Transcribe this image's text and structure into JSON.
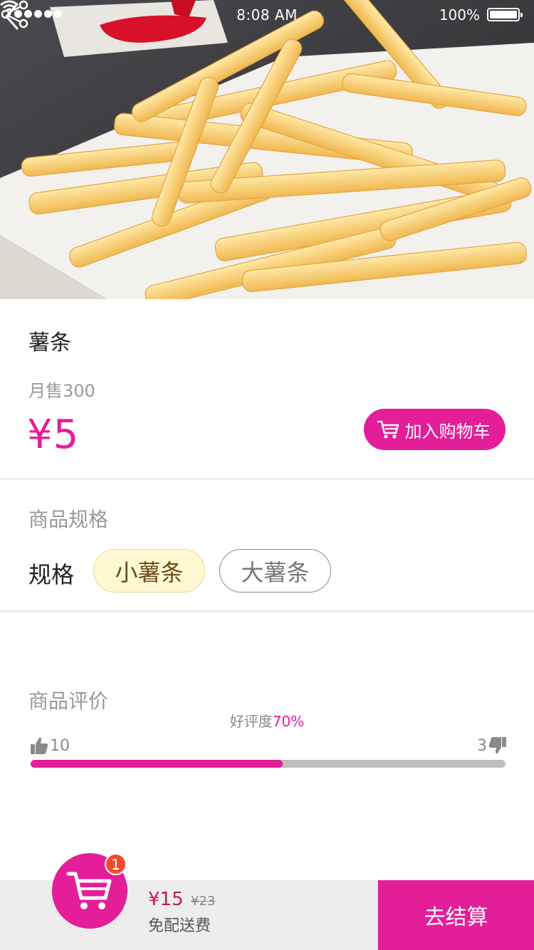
{
  "status_bar": {
    "time": "8:08 AM",
    "battery": "100%"
  },
  "product": {
    "name": "薯条",
    "monthly_sales": "月售300",
    "price": "¥5",
    "add_to_cart_label": "加入购物车"
  },
  "spec": {
    "section_title": "商品规格",
    "label": "规格",
    "options": [
      {
        "label": "小薯条",
        "selected": true
      },
      {
        "label": "大薯条",
        "selected": false
      }
    ]
  },
  "reviews": {
    "section_title": "商品评价",
    "positive_label": "好评度",
    "positive_rate": "70%",
    "likes": "10",
    "dislikes": "3",
    "bar_fraction": 0.53
  },
  "cart": {
    "count": "1",
    "total": "¥15",
    "original": "¥23",
    "delivery_note": "免配送费",
    "checkout_label": "去结算"
  },
  "colors": {
    "accent": "#e31e98",
    "selected_option_bg": "#fff8d2",
    "bottom_bar_bg": "#ededed"
  },
  "icons": [
    "back-icon",
    "share-icon",
    "cart-icon",
    "thumbs-up-icon",
    "thumbs-down-icon",
    "wifi-icon",
    "battery-icon"
  ]
}
